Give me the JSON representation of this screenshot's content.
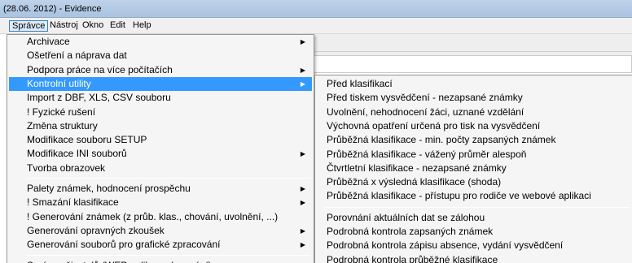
{
  "window": {
    "title": "(28.06. 2012)  -  Evidence"
  },
  "menubar": {
    "items": [
      "Správce",
      "Nástroj",
      "Okno",
      "Edit",
      "Help"
    ],
    "active": "Správce"
  },
  "menu": {
    "groups": [
      [
        {
          "label": "Archivace",
          "submenu": true
        },
        {
          "label": "Ošetření a náprava dat",
          "submenu": false
        },
        {
          "label": "Podpora práce na více počítačích",
          "submenu": true
        },
        {
          "label": "Kontrolní utility",
          "submenu": true,
          "highlighted": true
        },
        {
          "label": "Import z DBF, XLS, CSV souboru",
          "submenu": false
        },
        {
          "label": "! Fyzické rušení",
          "submenu": false
        },
        {
          "label": "Změna struktury",
          "submenu": false
        },
        {
          "label": "Modifikace souboru SETUP",
          "submenu": false
        },
        {
          "label": "Modifikace INI souborů",
          "submenu": true
        },
        {
          "label": "Tvorba obrazovek",
          "submenu": false
        }
      ],
      [
        {
          "label": "Palety známek, hodnocení prospěchu",
          "submenu": true
        },
        {
          "label": "! Smazání klasifikace",
          "submenu": true
        },
        {
          "label": "! Generování známek (z průb. klas., chování, uvolnění, ...)",
          "submenu": false
        },
        {
          "label": "Generování opravných zkoušek",
          "submenu": true
        },
        {
          "label": "Generování souborů pro grafické zpracování",
          "submenu": true
        }
      ],
      [
        {
          "label": "Správa uživatelů (WEB aplikace, logování)",
          "submenu": true
        }
      ]
    ]
  },
  "submenu": {
    "groups": [
      [
        "Před klasifikací",
        "Před tiskem vysvědčení - nezapsané známky",
        "Uvolnění,  nehodnocení žáci, uznané vzdělání",
        "Výchovná opatření určená pro tisk na vysvědčení",
        "Průběžná klasifikace - min. počty zapsaných známek",
        "Průběžná klasifikace - vážený průměr alespoň",
        "Čtvrtletní klasifikace - nezapsané známky",
        "Průběžná x výsledná klasifikace (shoda)",
        "Průběžná klasifikace - přístupu pro rodiče ve webové aplikaci"
      ],
      [
        "Porovnání aktuálních dat se zálohou",
        "Podrobná kontrola zapsaných známek",
        "Podrobná kontrola zápisu absence, vydání vysvědčení",
        "Podrobná kontrola průběžné klasifikace"
      ]
    ]
  },
  "colors": {
    "highlight": "#3399ff",
    "menu_bg": "#f5f5f5",
    "title_bar": "#bfd3ea"
  },
  "icons": {
    "submenu_arrow": "triangle-right-icon"
  }
}
